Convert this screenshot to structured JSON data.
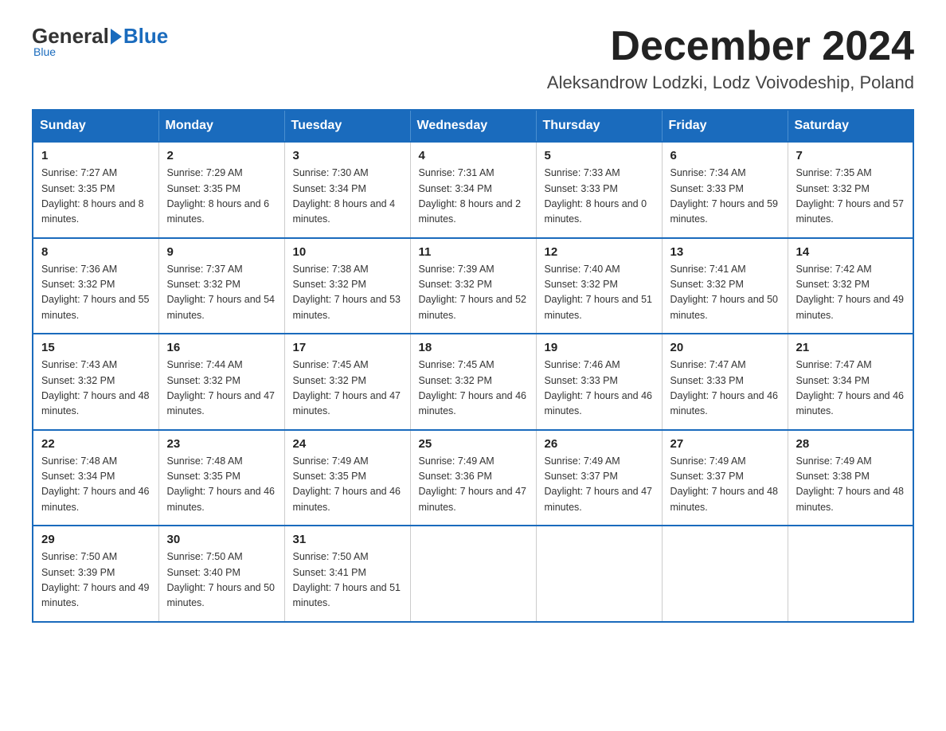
{
  "logo": {
    "general": "General",
    "blue": "Blue",
    "subtitle": "Blue"
  },
  "header": {
    "month": "December 2024",
    "location": "Aleksandrow Lodzki, Lodz Voivodeship, Poland"
  },
  "weekdays": [
    "Sunday",
    "Monday",
    "Tuesday",
    "Wednesday",
    "Thursday",
    "Friday",
    "Saturday"
  ],
  "weeks": [
    [
      {
        "day": "1",
        "sunrise": "7:27 AM",
        "sunset": "3:35 PM",
        "daylight": "8 hours and 8 minutes."
      },
      {
        "day": "2",
        "sunrise": "7:29 AM",
        "sunset": "3:35 PM",
        "daylight": "8 hours and 6 minutes."
      },
      {
        "day": "3",
        "sunrise": "7:30 AM",
        "sunset": "3:34 PM",
        "daylight": "8 hours and 4 minutes."
      },
      {
        "day": "4",
        "sunrise": "7:31 AM",
        "sunset": "3:34 PM",
        "daylight": "8 hours and 2 minutes."
      },
      {
        "day": "5",
        "sunrise": "7:33 AM",
        "sunset": "3:33 PM",
        "daylight": "8 hours and 0 minutes."
      },
      {
        "day": "6",
        "sunrise": "7:34 AM",
        "sunset": "3:33 PM",
        "daylight": "7 hours and 59 minutes."
      },
      {
        "day": "7",
        "sunrise": "7:35 AM",
        "sunset": "3:32 PM",
        "daylight": "7 hours and 57 minutes."
      }
    ],
    [
      {
        "day": "8",
        "sunrise": "7:36 AM",
        "sunset": "3:32 PM",
        "daylight": "7 hours and 55 minutes."
      },
      {
        "day": "9",
        "sunrise": "7:37 AM",
        "sunset": "3:32 PM",
        "daylight": "7 hours and 54 minutes."
      },
      {
        "day": "10",
        "sunrise": "7:38 AM",
        "sunset": "3:32 PM",
        "daylight": "7 hours and 53 minutes."
      },
      {
        "day": "11",
        "sunrise": "7:39 AM",
        "sunset": "3:32 PM",
        "daylight": "7 hours and 52 minutes."
      },
      {
        "day": "12",
        "sunrise": "7:40 AM",
        "sunset": "3:32 PM",
        "daylight": "7 hours and 51 minutes."
      },
      {
        "day": "13",
        "sunrise": "7:41 AM",
        "sunset": "3:32 PM",
        "daylight": "7 hours and 50 minutes."
      },
      {
        "day": "14",
        "sunrise": "7:42 AM",
        "sunset": "3:32 PM",
        "daylight": "7 hours and 49 minutes."
      }
    ],
    [
      {
        "day": "15",
        "sunrise": "7:43 AM",
        "sunset": "3:32 PM",
        "daylight": "7 hours and 48 minutes."
      },
      {
        "day": "16",
        "sunrise": "7:44 AM",
        "sunset": "3:32 PM",
        "daylight": "7 hours and 47 minutes."
      },
      {
        "day": "17",
        "sunrise": "7:45 AM",
        "sunset": "3:32 PM",
        "daylight": "7 hours and 47 minutes."
      },
      {
        "day": "18",
        "sunrise": "7:45 AM",
        "sunset": "3:32 PM",
        "daylight": "7 hours and 46 minutes."
      },
      {
        "day": "19",
        "sunrise": "7:46 AM",
        "sunset": "3:33 PM",
        "daylight": "7 hours and 46 minutes."
      },
      {
        "day": "20",
        "sunrise": "7:47 AM",
        "sunset": "3:33 PM",
        "daylight": "7 hours and 46 minutes."
      },
      {
        "day": "21",
        "sunrise": "7:47 AM",
        "sunset": "3:34 PM",
        "daylight": "7 hours and 46 minutes."
      }
    ],
    [
      {
        "day": "22",
        "sunrise": "7:48 AM",
        "sunset": "3:34 PM",
        "daylight": "7 hours and 46 minutes."
      },
      {
        "day": "23",
        "sunrise": "7:48 AM",
        "sunset": "3:35 PM",
        "daylight": "7 hours and 46 minutes."
      },
      {
        "day": "24",
        "sunrise": "7:49 AM",
        "sunset": "3:35 PM",
        "daylight": "7 hours and 46 minutes."
      },
      {
        "day": "25",
        "sunrise": "7:49 AM",
        "sunset": "3:36 PM",
        "daylight": "7 hours and 47 minutes."
      },
      {
        "day": "26",
        "sunrise": "7:49 AM",
        "sunset": "3:37 PM",
        "daylight": "7 hours and 47 minutes."
      },
      {
        "day": "27",
        "sunrise": "7:49 AM",
        "sunset": "3:37 PM",
        "daylight": "7 hours and 48 minutes."
      },
      {
        "day": "28",
        "sunrise": "7:49 AM",
        "sunset": "3:38 PM",
        "daylight": "7 hours and 48 minutes."
      }
    ],
    [
      {
        "day": "29",
        "sunrise": "7:50 AM",
        "sunset": "3:39 PM",
        "daylight": "7 hours and 49 minutes."
      },
      {
        "day": "30",
        "sunrise": "7:50 AM",
        "sunset": "3:40 PM",
        "daylight": "7 hours and 50 minutes."
      },
      {
        "day": "31",
        "sunrise": "7:50 AM",
        "sunset": "3:41 PM",
        "daylight": "7 hours and 51 minutes."
      },
      null,
      null,
      null,
      null
    ]
  ]
}
